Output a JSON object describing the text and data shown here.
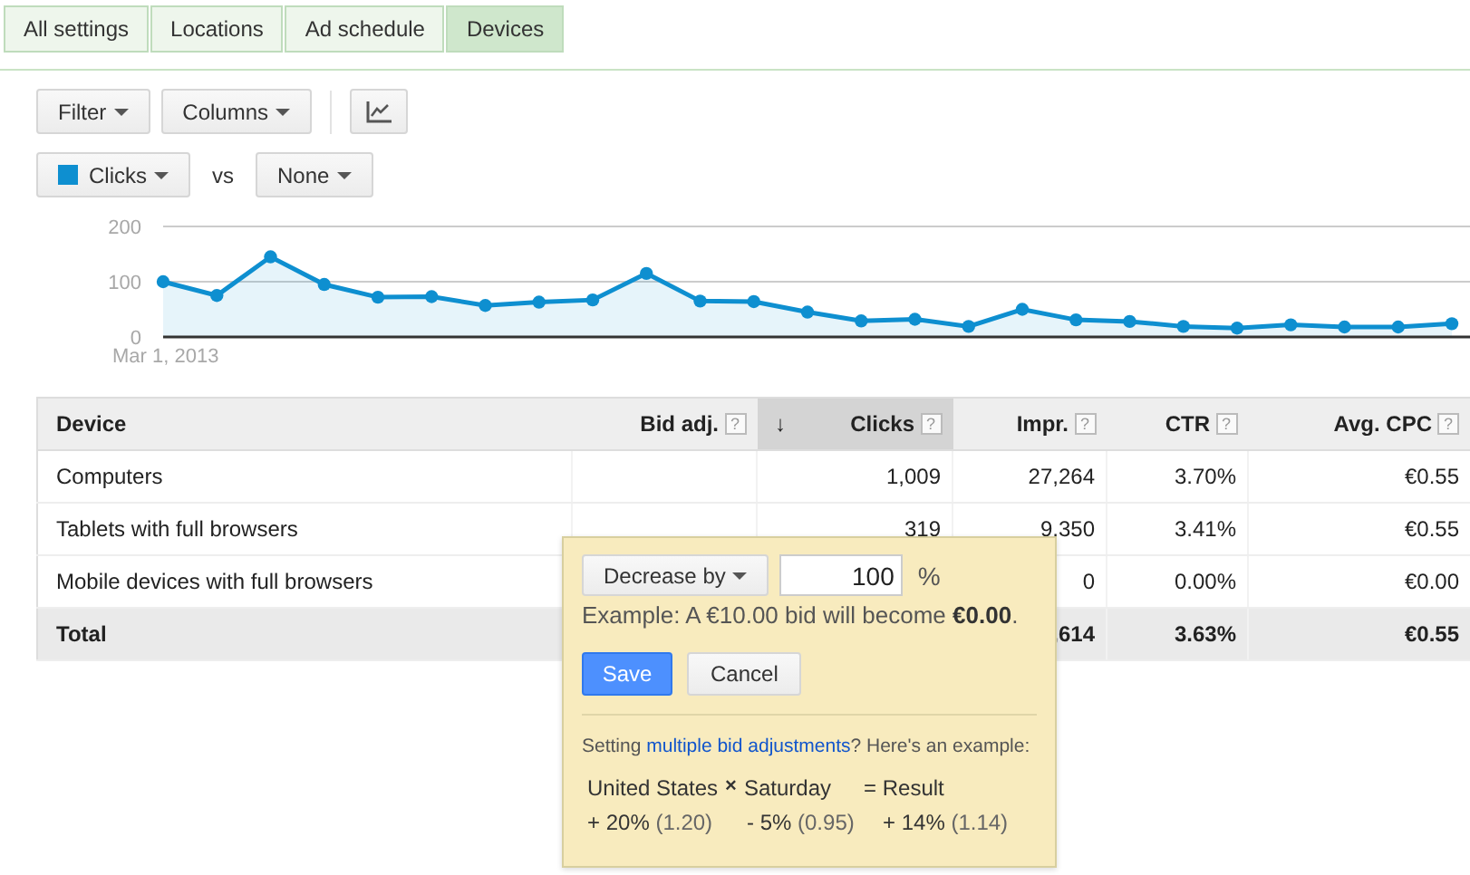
{
  "tabs": [
    {
      "label": "All settings",
      "selected": false
    },
    {
      "label": "Locations",
      "selected": false
    },
    {
      "label": "Ad schedule",
      "selected": false
    },
    {
      "label": "Devices",
      "selected": true
    }
  ],
  "toolbar": {
    "filter": "Filter",
    "columns": "Columns"
  },
  "metrics": {
    "vs": "vs",
    "secondary": "None"
  },
  "chart_data": {
    "type": "area",
    "series": [
      {
        "name": "Clicks",
        "color": "#0e8fd0",
        "marker": true,
        "values": [
          100,
          75,
          145,
          95,
          72,
          73,
          57,
          63,
          67,
          115,
          65,
          64,
          45,
          29,
          32,
          19,
          50,
          31,
          28,
          19,
          16,
          22,
          18,
          18,
          24
        ]
      }
    ],
    "ylim": [
      0,
      200
    ],
    "yticks": [
      {
        "value": 0,
        "label": "0"
      },
      {
        "value": 100,
        "label": "100"
      },
      {
        "value": 200,
        "label": "200"
      }
    ],
    "annotations": [
      {
        "text": "Mar 1, 2013"
      }
    ]
  },
  "table": {
    "columns": [
      {
        "label": "Device",
        "sorted": false
      },
      {
        "label": "Bid adj.",
        "help": "?",
        "sorted": false
      },
      {
        "label": "Clicks",
        "help": "?",
        "sorted": true,
        "sort_icon": "↓"
      },
      {
        "label": "Impr.",
        "help": "?",
        "sorted": false
      },
      {
        "label": "CTR",
        "help": "?",
        "sorted": false
      },
      {
        "label": "Avg. CPC",
        "help": "?",
        "sorted": false
      }
    ],
    "rows": [
      {
        "cells": [
          "Computers",
          "",
          "1,009",
          "27,264",
          "3.70%",
          "€0.55"
        ],
        "total": false
      },
      {
        "cells": [
          "Tablets with full browsers",
          "",
          "319",
          "9,350",
          "3.41%",
          "€0.55"
        ],
        "total": false
      },
      {
        "cells": [
          "Mobile devices with full browsers",
          "",
          "",
          "0",
          "0.00%",
          "€0.00"
        ],
        "total": false
      },
      {
        "cells": [
          "Total",
          "",
          "",
          ",614",
          "3.63%",
          "€0.55"
        ],
        "total": true
      }
    ]
  },
  "popup": {
    "mode": "Decrease by",
    "value": "100",
    "unit": "%",
    "example": "Example: A €10.00 bid will become **€0.00**.",
    "save": "Save",
    "cancel": "Cancel",
    "help_before": "Setting ",
    "help_link": "multiple bid adjustments",
    "help_after": "? Here's an example:",
    "example_rows": [
      [
        "United States",
        "×",
        "Saturday",
        "= Result"
      ],
      [
        "+ 20%",
        "(1.20)",
        "- 5%",
        "(0.95)",
        "+ 14%",
        "(1.14)"
      ]
    ]
  }
}
